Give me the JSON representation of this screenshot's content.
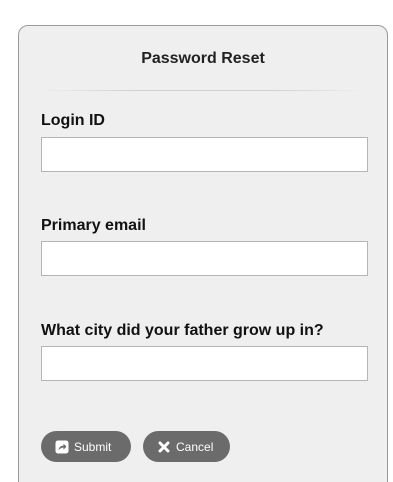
{
  "form": {
    "title": "Password Reset",
    "fields": [
      {
        "label": "Login ID",
        "value": "",
        "placeholder": ""
      },
      {
        "label": "Primary email",
        "value": "",
        "placeholder": ""
      },
      {
        "label": "What city did your father grow up in?",
        "value": "",
        "placeholder": ""
      }
    ],
    "buttons": {
      "submit": {
        "label": "Submit",
        "icon": "share-icon"
      },
      "cancel": {
        "label": "Cancel",
        "icon": "close-icon"
      }
    }
  },
  "colors": {
    "panel_background": "#efefef",
    "panel_border": "#9a9a9a",
    "button_background": "#6b6b6b",
    "button_text": "#ffffff"
  }
}
